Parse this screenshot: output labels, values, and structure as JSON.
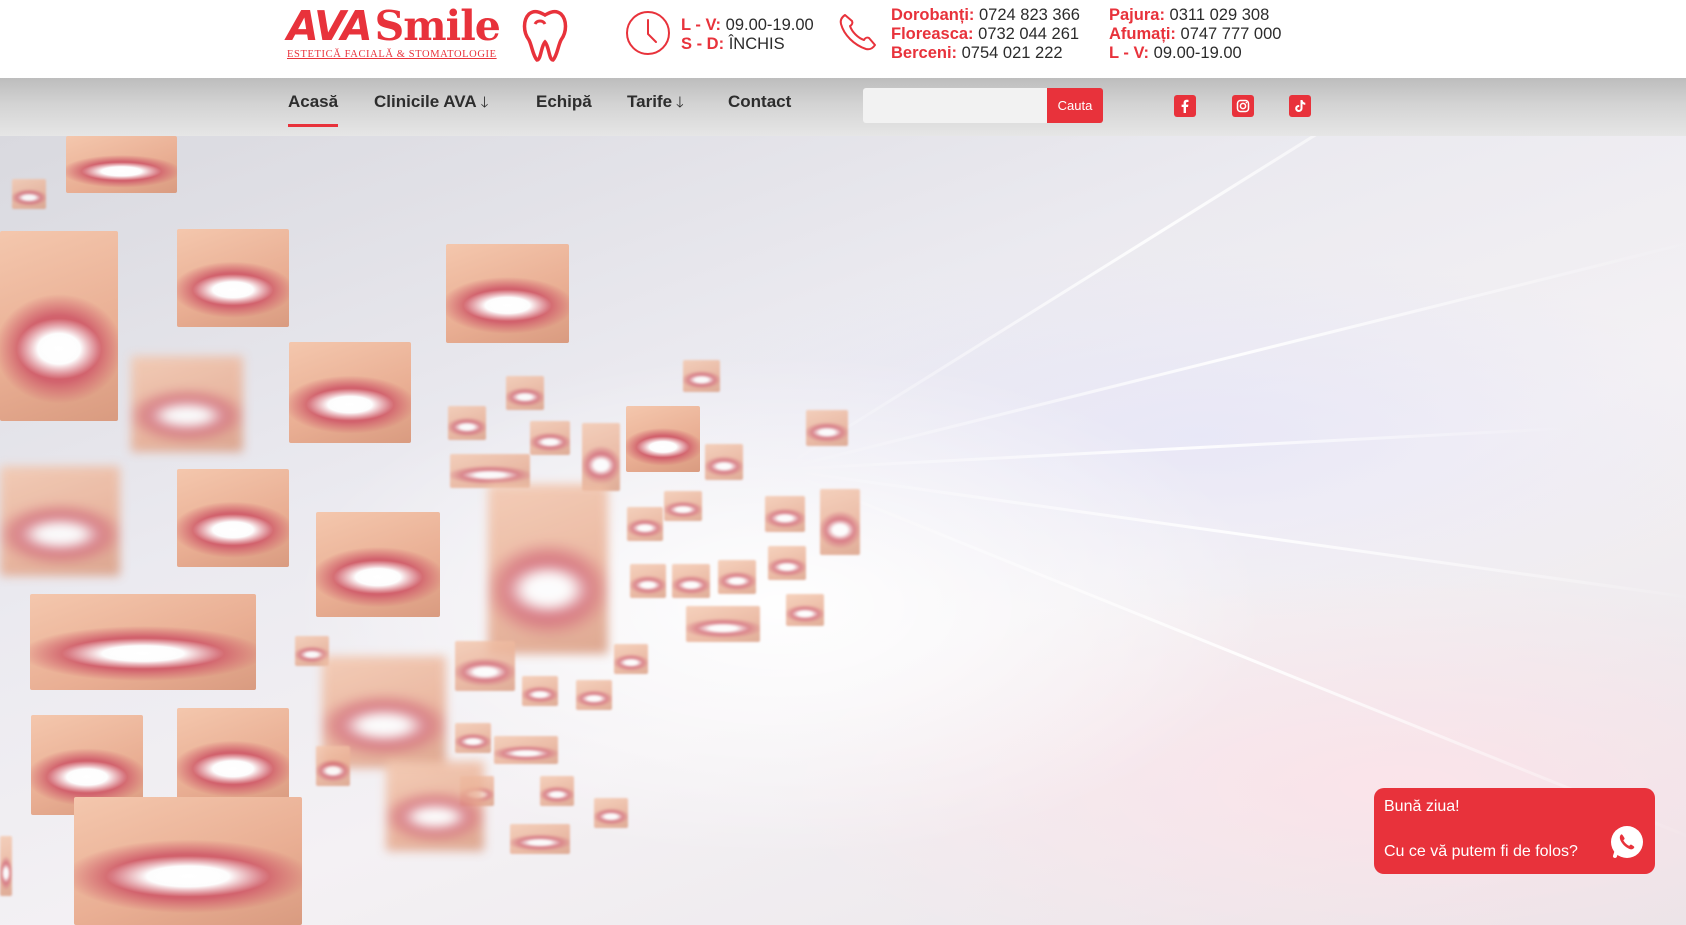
{
  "brand": {
    "name_ava": "AVA",
    "name_smile": "Smile",
    "tagline": "ESTETICĂ FACIALĂ & STOMATOLOGIE",
    "accent_color": "#e8323b"
  },
  "hours": {
    "weekdays_label": "L - V:",
    "weekdays_value": "09.00-19.00",
    "weekend_label": "S - D:",
    "weekend_value": "ÎNCHIS",
    "icon": "clock-icon"
  },
  "phones": {
    "icon": "phone-icon",
    "col1": [
      {
        "label": "Dorobanți:",
        "value": "0724 823 366"
      },
      {
        "label": "Floreasca:",
        "value": "0732 044 261"
      },
      {
        "label": "Berceni:",
        "value": "0754 021 222"
      }
    ],
    "col2": [
      {
        "label": "Pajura:",
        "value": "0311 029 308"
      },
      {
        "label": "Afumați:",
        "value": "0747 777 000"
      },
      {
        "label": "L - V:",
        "value": "09.00-19.00"
      }
    ]
  },
  "nav": {
    "items": [
      {
        "label": "Acasă",
        "active": true
      },
      {
        "label": "Clinicile AVA",
        "dropdown": true
      },
      {
        "label": "Echipă"
      },
      {
        "label": "Tarife",
        "dropdown": true
      },
      {
        "label": "Contact"
      }
    ],
    "arrow": "🡓"
  },
  "search": {
    "placeholder": "",
    "button_label": "Cauta"
  },
  "social": [
    "facebook-icon",
    "instagram-icon",
    "tiktok-icon"
  ],
  "chat": {
    "line1": "Bună ziua!",
    "line2": "Cu ce vă putem fi de folos?",
    "icon": "whatsapp-icon"
  }
}
